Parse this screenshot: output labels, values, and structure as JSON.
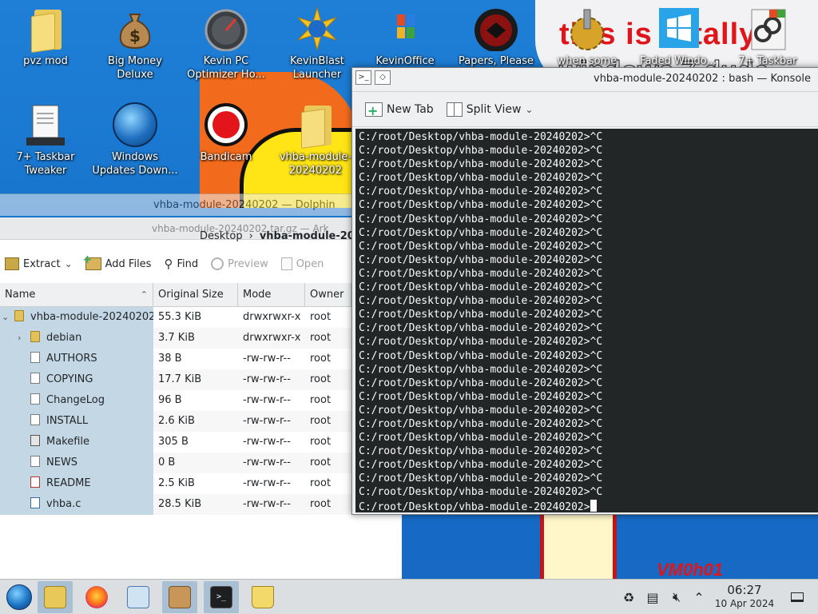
{
  "desktop": {
    "wallpaper_text": [
      "this is totally",
      "windows 7 dude",
      "VM0h01"
    ],
    "icons": [
      {
        "label": "pvz mod",
        "icon": "folder-icon"
      },
      {
        "label": "Big Money Deluxe",
        "icon": "money-bag-icon"
      },
      {
        "label": "Kevin PC Optimizer Ho...",
        "icon": "speedometer-icon"
      },
      {
        "label": "KevinBlast Launcher",
        "icon": "kevinblast-icon"
      },
      {
        "label": "KevinOffice 2009",
        "icon": "office-icon"
      },
      {
        "label": "Papers, Please",
        "icon": "papers-please-icon"
      },
      {
        "label": "when some russian ...",
        "icon": "gear-icon"
      },
      {
        "label": "Faded Windo...",
        "icon": "windows-tile-icon"
      },
      {
        "label": "7+ Taskbar Tweaker",
        "icon": "windows-link-icon"
      },
      {
        "label": "7+ Taskbar Tweaker",
        "icon": "tweaker-icon"
      },
      {
        "label": "Windows Updates Down...",
        "icon": "windows-orb-icon"
      },
      {
        "label": "Bandicam",
        "icon": "bandicam-icon"
      },
      {
        "label": "vhba-module-20240202",
        "icon": "folder-icon"
      }
    ]
  },
  "konsole": {
    "title": "vhba-module-20240202 : bash — Konsole",
    "toolbar": {
      "new_tab": "New Tab",
      "split_view": "Split View"
    },
    "lines": [
      "C:/root/Desktop/vhba-module-20240202>^C",
      "C:/root/Desktop/vhba-module-20240202>^C",
      "C:/root/Desktop/vhba-module-20240202>^C",
      "C:/root/Desktop/vhba-module-20240202>^C",
      "C:/root/Desktop/vhba-module-20240202>^C",
      "C:/root/Desktop/vhba-module-20240202>^C",
      "C:/root/Desktop/vhba-module-20240202>^C",
      "C:/root/Desktop/vhba-module-20240202>^C",
      "C:/root/Desktop/vhba-module-20240202>^C",
      "C:/root/Desktop/vhba-module-20240202>^C",
      "C:/root/Desktop/vhba-module-20240202>^C",
      "C:/root/Desktop/vhba-module-20240202>^C",
      "C:/root/Desktop/vhba-module-20240202>^C",
      "C:/root/Desktop/vhba-module-20240202>^C",
      "C:/root/Desktop/vhba-module-20240202>^C",
      "C:/root/Desktop/vhba-module-20240202>^C",
      "C:/root/Desktop/vhba-module-20240202>^C",
      "C:/root/Desktop/vhba-module-20240202>^C",
      "C:/root/Desktop/vhba-module-20240202>^C",
      "C:/root/Desktop/vhba-module-20240202>^C",
      "C:/root/Desktop/vhba-module-20240202>^C",
      "C:/root/Desktop/vhba-module-20240202>^C",
      "C:/root/Desktop/vhba-module-20240202>^C",
      "C:/root/Desktop/vhba-module-20240202>^C",
      "C:/root/Desktop/vhba-module-20240202>^C",
      "C:/root/Desktop/vhba-module-20240202>^C",
      "C:/root/Desktop/vhba-module-20240202>^C"
    ],
    "prompt": "C:/root/Desktop/vhba-module-20240202>"
  },
  "dolphin": {
    "title": "vhba-module-20240202 — Dolphin",
    "breadcrumb": [
      "Desktop",
      "vhba-module-20240202"
    ]
  },
  "ark": {
    "title": "vhba-module-20240202.tar.gz — Ark",
    "toolbar": {
      "extract": "Extract",
      "add_files": "Add Files",
      "find": "Find",
      "preview": "Preview",
      "open": "Open"
    },
    "columns": [
      "Name",
      "Original Size",
      "Mode",
      "Owner"
    ],
    "rows": [
      {
        "name": "vhba-module-20240202",
        "size": "55.3 KiB",
        "mode": "drwxrwxr-x",
        "owner": "root",
        "kind": "folder",
        "tree": "⌄",
        "indent": 0
      },
      {
        "name": "debian",
        "size": "3.7 KiB",
        "mode": "drwxrwxr-x",
        "owner": "root",
        "kind": "folder",
        "tree": "›",
        "indent": 1
      },
      {
        "name": "AUTHORS",
        "size": "38 B",
        "mode": "-rw-rw-r--",
        "owner": "root",
        "kind": "text",
        "tree": "",
        "indent": 1
      },
      {
        "name": "COPYING",
        "size": "17.7 KiB",
        "mode": "-rw-rw-r--",
        "owner": "root",
        "kind": "text",
        "tree": "",
        "indent": 1
      },
      {
        "name": "ChangeLog",
        "size": "96 B",
        "mode": "-rw-rw-r--",
        "owner": "root",
        "kind": "text",
        "tree": "",
        "indent": 1
      },
      {
        "name": "INSTALL",
        "size": "2.6 KiB",
        "mode": "-rw-rw-r--",
        "owner": "root",
        "kind": "text",
        "tree": "",
        "indent": 1
      },
      {
        "name": "Makefile",
        "size": "305 B",
        "mode": "-rw-rw-r--",
        "owner": "root",
        "kind": "make",
        "tree": "",
        "indent": 1
      },
      {
        "name": "NEWS",
        "size": "0 B",
        "mode": "-rw-rw-r--",
        "owner": "root",
        "kind": "text",
        "tree": "",
        "indent": 1
      },
      {
        "name": "README",
        "size": "2.5 KiB",
        "mode": "-rw-rw-r--",
        "owner": "root",
        "kind": "readme",
        "tree": "",
        "indent": 1
      },
      {
        "name": "vhba.c",
        "size": "28.5 KiB",
        "mode": "-rw-rw-r--",
        "owner": "root",
        "kind": "code",
        "tree": "",
        "indent": 1
      }
    ]
  },
  "taskbar": {
    "items": [
      "start-menu",
      "dolphin",
      "firefox",
      "system-settings",
      "ark",
      "konsole",
      "bag"
    ],
    "time": "06:27",
    "date": "10 Apr 2024"
  },
  "colors": {
    "terminal_bg": "#232627",
    "selection": "#c4d7e4",
    "taskbar_active": "#a9bfd3"
  }
}
